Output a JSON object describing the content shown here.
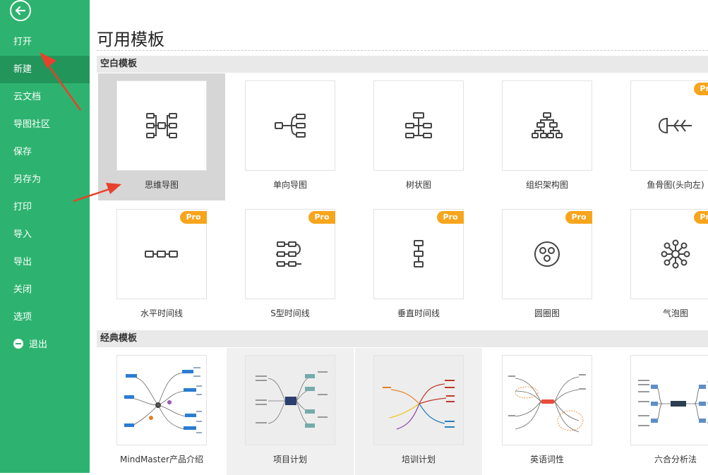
{
  "sidebar": {
    "items": [
      {
        "label": "打开",
        "active": false
      },
      {
        "label": "新建",
        "active": true
      },
      {
        "label": "云文档",
        "active": false
      },
      {
        "label": "导图社区",
        "active": false
      },
      {
        "label": "保存",
        "active": false
      },
      {
        "label": "另存为",
        "active": false
      },
      {
        "label": "打印",
        "active": false
      },
      {
        "label": "导入",
        "active": false
      },
      {
        "label": "导出",
        "active": false
      },
      {
        "label": "关闭",
        "active": false
      },
      {
        "label": "选项",
        "active": false
      },
      {
        "label": "退出",
        "active": false
      }
    ]
  },
  "main": {
    "title": "可用模板",
    "blank_section": "空白模板",
    "classic_section": "经典模板",
    "blank_templates": [
      {
        "label": "思维导图",
        "pro": false,
        "icon": "mindmap-icon"
      },
      {
        "label": "单向导图",
        "pro": false,
        "icon": "right-map-icon"
      },
      {
        "label": "树状图",
        "pro": false,
        "icon": "tree-map-icon"
      },
      {
        "label": "组织架构图",
        "pro": false,
        "icon": "org-chart-icon"
      },
      {
        "label": "鱼骨图(头向左)",
        "pro": true,
        "icon": "fishbone-icon"
      },
      {
        "label": "水平时间线",
        "pro": true,
        "icon": "horizontal-timeline-icon"
      },
      {
        "label": "S型时间线",
        "pro": true,
        "icon": "s-timeline-icon"
      },
      {
        "label": "垂直时间线",
        "pro": true,
        "icon": "vertical-timeline-icon"
      },
      {
        "label": "圆圈图",
        "pro": true,
        "icon": "circle-map-icon"
      },
      {
        "label": "气泡图",
        "pro": true,
        "icon": "bubble-map-icon"
      }
    ],
    "classic_templates": [
      {
        "label": "MindMaster产品介绍"
      },
      {
        "label": "项目计划"
      },
      {
        "label": "培训计划"
      },
      {
        "label": "英语词性"
      },
      {
        "label": "六合分析法"
      }
    ],
    "pro_label": "Pro"
  },
  "colors": {
    "sidebar": "#2db36f",
    "sidebar_active": "#22955b",
    "pro": "#f7a51c",
    "arrow": "#e8412b"
  }
}
